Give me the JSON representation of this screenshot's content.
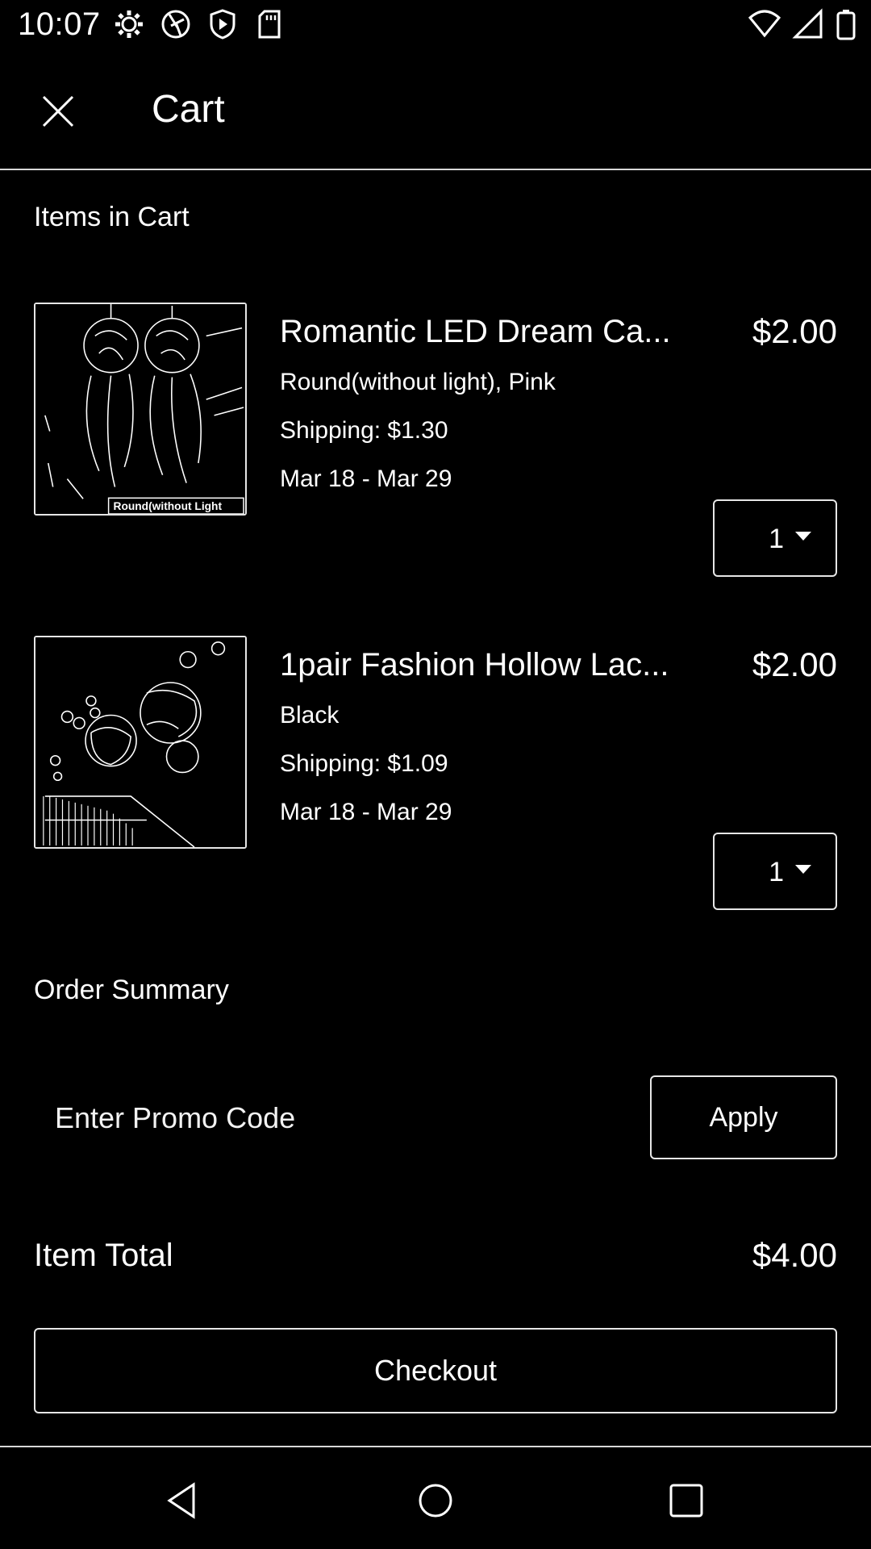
{
  "status_bar": {
    "time": "10:07",
    "left_icons": [
      "gear-icon",
      "aperture-icon",
      "shield-play-icon",
      "sd-card-icon"
    ],
    "right_icons": [
      "wifi-icon",
      "cell-signal-icon",
      "battery-icon"
    ]
  },
  "header": {
    "close_icon": "close-icon",
    "title": "Cart"
  },
  "items_section": {
    "title": "Items in Cart"
  },
  "items": [
    {
      "name": "Romantic LED Dream Ca...",
      "price": "$2.00",
      "variant": "Round(without light), Pink",
      "shipping": "Shipping: $1.30",
      "delivery": "Mar 18 - Mar 29",
      "quantity": "1",
      "image_label": "Round(without Light"
    },
    {
      "name": "1pair Fashion Hollow Lac...",
      "price": "$2.00",
      "variant": "Black",
      "shipping": "Shipping: $1.09",
      "delivery": "Mar 18 - Mar 29",
      "quantity": "1"
    }
  ],
  "summary": {
    "title": "Order Summary",
    "promo_placeholder": "Enter Promo Code",
    "apply_label": "Apply",
    "item_total_label": "Item Total",
    "item_total_value": "$4.00",
    "checkout_label": "Checkout"
  },
  "nav": {
    "back_icon": "back-triangle-icon",
    "home_icon": "home-circle-icon",
    "recents_icon": "recents-square-icon"
  },
  "colors": {
    "background": "#000000",
    "foreground": "#ffffff",
    "divider": "#d8d8d8"
  }
}
